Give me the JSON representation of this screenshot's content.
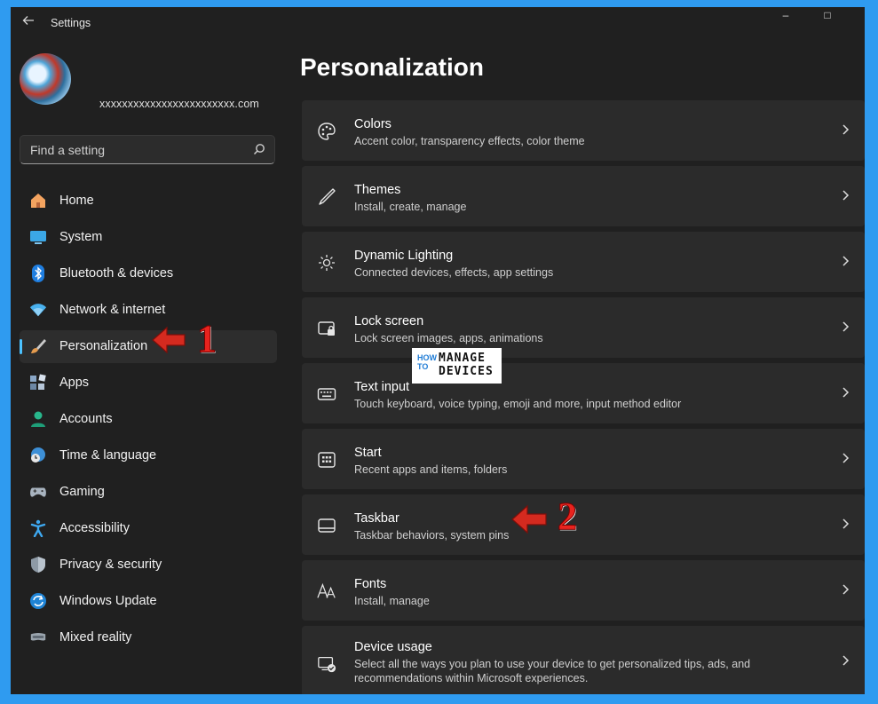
{
  "window": {
    "title": "Settings",
    "controls": {
      "minimize": "–",
      "maximize": "□",
      "close": "✕"
    }
  },
  "profile": {
    "email": "xxxxxxxxxxxxxxxxxxxxxxxx.com"
  },
  "search": {
    "placeholder": "Find a setting"
  },
  "sidebar": {
    "items": [
      {
        "label": "Home",
        "icon": "home-icon"
      },
      {
        "label": "System",
        "icon": "system-icon"
      },
      {
        "label": "Bluetooth & devices",
        "icon": "bluetooth-icon"
      },
      {
        "label": "Network & internet",
        "icon": "wifi-icon"
      },
      {
        "label": "Personalization",
        "icon": "brush-icon",
        "active": true
      },
      {
        "label": "Apps",
        "icon": "apps-icon"
      },
      {
        "label": "Accounts",
        "icon": "account-icon"
      },
      {
        "label": "Time & language",
        "icon": "globe-clock-icon"
      },
      {
        "label": "Gaming",
        "icon": "gamepad-icon"
      },
      {
        "label": "Accessibility",
        "icon": "accessibility-icon"
      },
      {
        "label": "Privacy & security",
        "icon": "shield-icon"
      },
      {
        "label": "Windows Update",
        "icon": "update-icon"
      },
      {
        "label": "Mixed reality",
        "icon": "headset-icon"
      }
    ]
  },
  "main": {
    "title": "Personalization",
    "cards": [
      {
        "title": "Colors",
        "subtitle": "Accent color, transparency effects, color theme",
        "icon": "palette-icon"
      },
      {
        "title": "Themes",
        "subtitle": "Install, create, manage",
        "icon": "pen-icon"
      },
      {
        "title": "Dynamic Lighting",
        "subtitle": "Connected devices, effects, app settings",
        "icon": "lighting-icon"
      },
      {
        "title": "Lock screen",
        "subtitle": "Lock screen images, apps, animations",
        "icon": "lock-screen-icon"
      },
      {
        "title": "Text input",
        "subtitle": "Touch keyboard, voice typing, emoji and more, input method editor",
        "icon": "keyboard-icon"
      },
      {
        "title": "Start",
        "subtitle": "Recent apps and items, folders",
        "icon": "start-icon"
      },
      {
        "title": "Taskbar",
        "subtitle": "Taskbar behaviors, system pins",
        "icon": "taskbar-icon"
      },
      {
        "title": "Fonts",
        "subtitle": "Install, manage",
        "icon": "fonts-icon"
      },
      {
        "title": "Device usage",
        "subtitle": "Select all the ways you plan to use your device to get personalized tips, ads, and recommendations within Microsoft experiences.",
        "icon": "device-usage-icon"
      }
    ]
  },
  "annotations": {
    "marker_1": "1",
    "marker_2": "2",
    "arrow_color": "#d42a1f"
  },
  "watermark": {
    "how": "HOW",
    "to": "TO",
    "manage": "MANAGE",
    "devices": "DEVICES"
  },
  "colors": {
    "accent": "#4cc2ff",
    "frame": "#2f9bf0",
    "window_bg": "#202020",
    "card_bg": "#2b2b2b"
  }
}
